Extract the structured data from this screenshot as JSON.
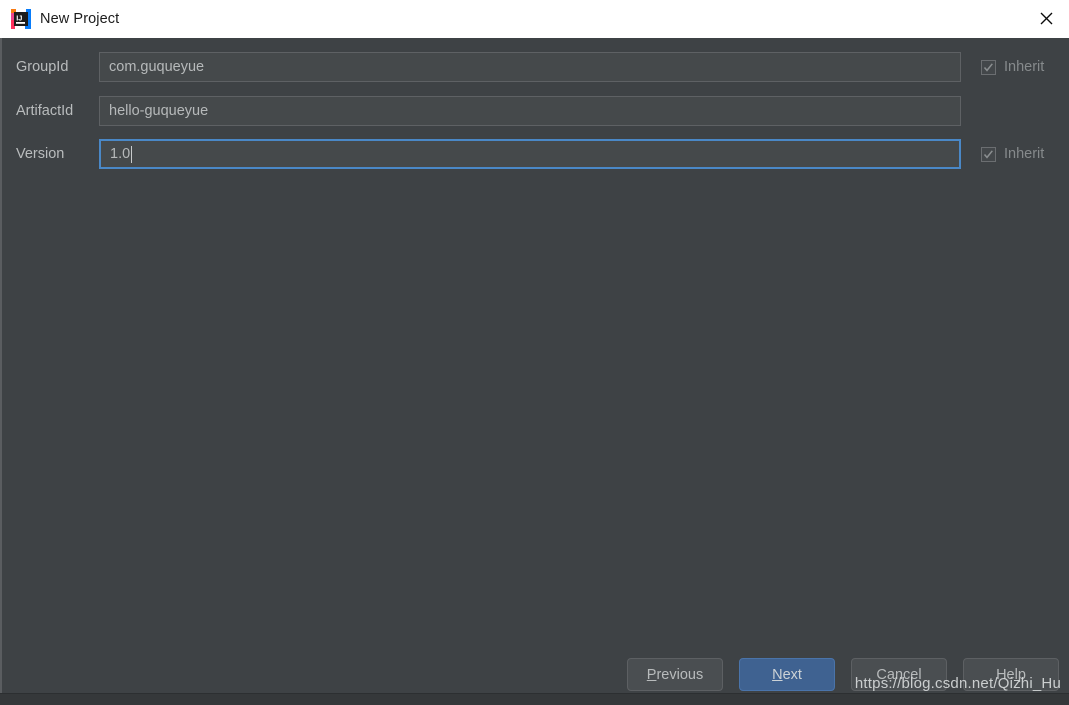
{
  "window": {
    "title": "New Project",
    "logo_icon": "intellij-idea-logo",
    "close_icon": "close-icon"
  },
  "form": {
    "fields": [
      {
        "label": "GroupId",
        "value": "com.guqueyue",
        "placeholder": "",
        "focused": false,
        "inherit": {
          "label": "Inherit",
          "checked": true,
          "enabled": false
        }
      },
      {
        "label": "ArtifactId",
        "value": "hello-guqueyue",
        "placeholder": "",
        "focused": false,
        "inherit": null
      },
      {
        "label": "Version",
        "value": "1.0",
        "placeholder": "",
        "focused": true,
        "inherit": {
          "label": "Inherit",
          "checked": true,
          "enabled": false
        }
      }
    ]
  },
  "buttons": {
    "previous": {
      "prefix": "",
      "mnemonic": "P",
      "suffix": "revious"
    },
    "next": {
      "prefix": "",
      "mnemonic": "N",
      "suffix": "ext"
    },
    "cancel": {
      "label": "Cancel"
    },
    "help": {
      "label": "Help"
    }
  },
  "watermark": {
    "text": "https://blog.csdn.net/Qizhi_Hu"
  },
  "colors": {
    "dialog_background": "#3e4245",
    "titlebar_background": "#ffffff",
    "field_background": "#45494b",
    "focus_border": "#4a88c7",
    "primary_button": "#3f6291",
    "label_text": "#b9bcbd"
  }
}
